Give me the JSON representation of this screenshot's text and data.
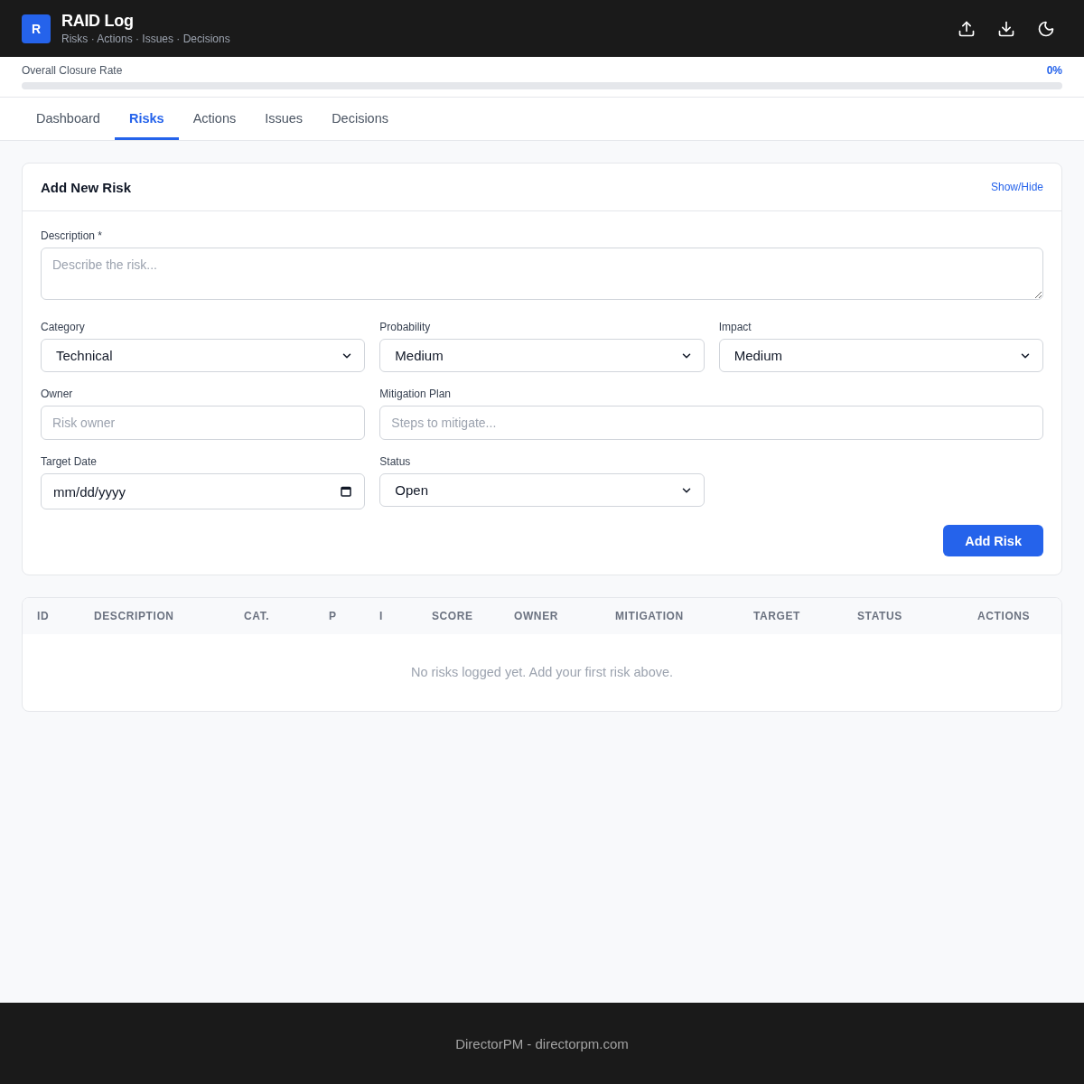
{
  "header": {
    "logo_letter": "R",
    "title": "RAID Log",
    "subtitle": "Risks · Actions · Issues · Decisions"
  },
  "closure": {
    "label": "Overall Closure Rate",
    "reading": "0%",
    "level": 0
  },
  "tabs": [
    {
      "label": "Dashboard",
      "selected": false
    },
    {
      "label": "Risks",
      "selected": true
    },
    {
      "label": "Actions",
      "selected": false
    },
    {
      "label": "Issues",
      "selected": false
    },
    {
      "label": "Decisions",
      "selected": false
    }
  ],
  "form": {
    "title": "Add New Risk",
    "toggle": "Show/Hide",
    "fields": [
      {
        "kind": "textarea",
        "label": "Description *",
        "placeholder": "Describe the risk..."
      },
      {
        "kind": "select",
        "label": "Category",
        "value": "Technical"
      },
      {
        "kind": "select",
        "label": "Probability",
        "value": "Medium"
      },
      {
        "kind": "select",
        "label": "Impact",
        "value": "Medium"
      },
      {
        "kind": "text",
        "label": "Owner",
        "placeholder": "Risk owner"
      },
      {
        "kind": "long-text",
        "label": "Mitigation Plan",
        "placeholder": "Steps to mitigate..."
      },
      {
        "kind": "date",
        "label": "Target Date",
        "placeholder": "mm/dd/yyyy"
      },
      {
        "kind": "select",
        "label": "Status",
        "value": "Open"
      }
    ],
    "submit": "Add Risk"
  },
  "table": {
    "columns": [
      "ID",
      "DESCRIPTION",
      "CAT.",
      "P",
      "I",
      "SCORE",
      "OWNER",
      "MITIGATION",
      "TARGET",
      "STATUS",
      "ACTIONS"
    ],
    "empty_message": "No risks logged yet. Add your first risk above."
  },
  "footer": {
    "text": "DirectorPM - directorpm.com"
  }
}
